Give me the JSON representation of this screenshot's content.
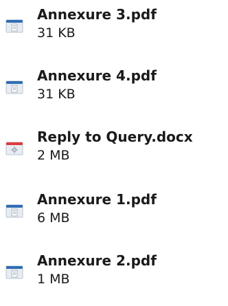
{
  "files": [
    {
      "name": "Annexure 3.pdf",
      "size": "31 KB",
      "icon": "pdf-document-icon",
      "tab_color": "#2f6db5"
    },
    {
      "name": "Annexure 4.pdf",
      "size": "31 KB",
      "icon": "pdf-document-icon",
      "tab_color": "#2f6db5"
    },
    {
      "name": "Reply to Query.docx",
      "size": "2 MB",
      "icon": "docx-document-icon",
      "tab_color": "#e03a3e"
    },
    {
      "name": "Annexure 1.pdf",
      "size": "6 MB",
      "icon": "pdf-document-icon",
      "tab_color": "#2f6db5"
    },
    {
      "name": "Annexure 2.pdf",
      "size": "1 MB",
      "icon": "pdf-document-icon",
      "tab_color": "#2f6db5"
    }
  ]
}
